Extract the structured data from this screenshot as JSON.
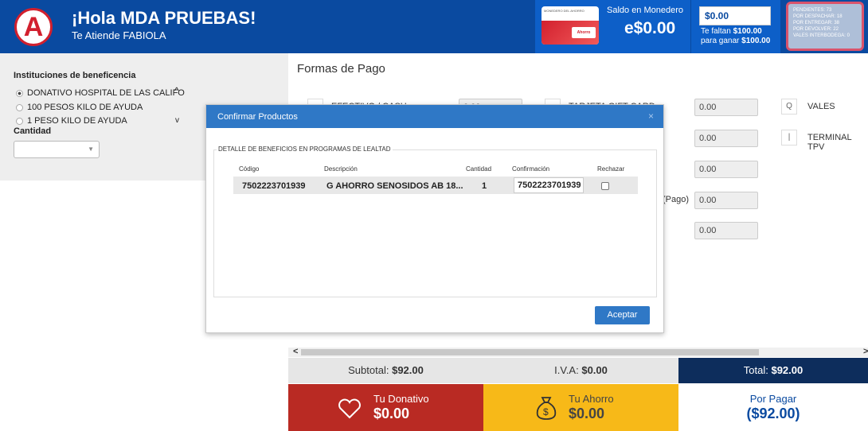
{
  "header": {
    "greeting": "¡Hola MDA PRUEBAS!",
    "agent": "Te Atiende FABIOLA",
    "card_caption": "MONEDERO DEL AHORRO",
    "card_brand": "Ahorro",
    "monedero_label": "Saldo en Monedero",
    "monedero_value": "e$0.00",
    "goal_value": "$0.00",
    "goal_line1_prefix": "Te faltan ",
    "goal_line1_amount": "$100.00",
    "goal_line2_prefix": "para ganar ",
    "goal_line2_amount": "$100.00",
    "status_lines": [
      "PENDIENTES: 73",
      "POR DESPACHAR: 18",
      "POR ENTREGAR: 38",
      "POR DEVOLVER: 22",
      "VALES INTERBODEGA: 0"
    ],
    "colors": {
      "bar": "#0a4aa0",
      "accent_red": "#d2202e"
    }
  },
  "left": {
    "title": "Instituciones de beneficencia",
    "options": [
      {
        "label": "DONATIVO HOSPITAL DE LAS CALIFO",
        "selected": true
      },
      {
        "label": "100 PESOS KILO DE AYUDA",
        "selected": false
      },
      {
        "label": "1 PESO KILO DE AYUDA",
        "selected": false
      }
    ],
    "qty_label": "Cantidad",
    "qty_value": "",
    "scroll_up": "^",
    "scroll_down": "v"
  },
  "main": {
    "title": "Formas de Pago",
    "col1_labels": [
      "EFECTIVO / CASH",
      "",
      ""
    ],
    "col1_values": [
      "0.00"
    ],
    "col2_labels": [
      "TARJETA GIFT CARD",
      "(Pago)"
    ],
    "col2_values": [
      "0.00",
      "0.00",
      "0.00",
      "0.00",
      "0.00"
    ],
    "col3": [
      {
        "icon": "search-icon",
        "glyph": "Q",
        "label": "VALES"
      },
      {
        "icon": "terminal-icon",
        "glyph": "|",
        "label": "TERMINAL TPV"
      }
    ],
    "scroll_left": "<",
    "scroll_right": ">"
  },
  "totals": {
    "subtotal_label": "Subtotal:",
    "subtotal_value": "$92.00",
    "iva_label": "I.V.A:",
    "iva_value": "$0.00",
    "total_label": "Total:",
    "total_value": "$92.00"
  },
  "bottom": {
    "donativo_label": "Tu Donativo",
    "donativo_value": "$0.00",
    "ahorro_label": "Tu Ahorro",
    "ahorro_value": "$0.00",
    "pagar_label": "Por Pagar",
    "pagar_value": "($92.00)",
    "colors": {
      "donativo": "#b92a23",
      "ahorro": "#f7b918",
      "total": "#0d2d5c"
    }
  },
  "dialog": {
    "title": "Confirmar Productos",
    "close": "×",
    "legend": "DETALLE DE BENEFICIOS EN PROGRAMAS DE LEALTAD",
    "headers": [
      "Código",
      "Descripción",
      "Cantidad",
      "Confirmación",
      "Rechazar"
    ],
    "row": {
      "codigo": "7502223701939",
      "descripcion": "G AHORRO SENOSIDOS AB 18...",
      "cantidad": "1",
      "confirmacion": "7502223701939",
      "rechazar": false
    },
    "ok_label": "Aceptar",
    "color": "#2f78c6"
  }
}
